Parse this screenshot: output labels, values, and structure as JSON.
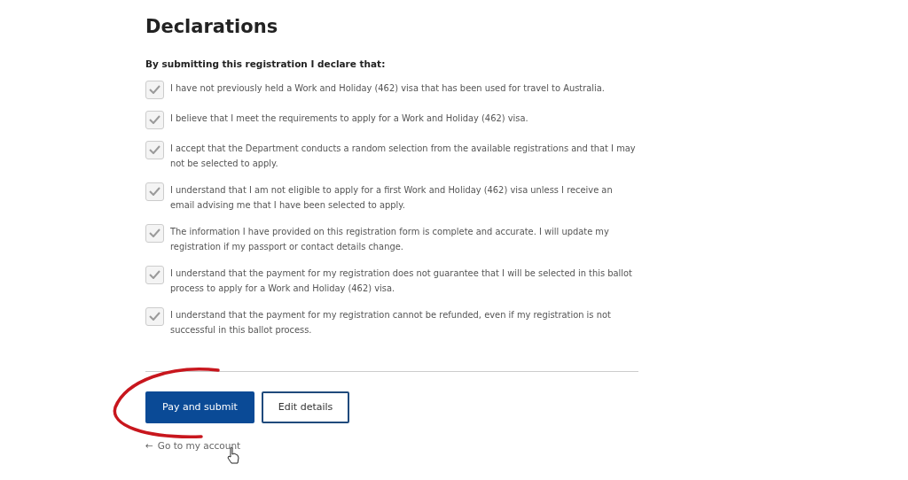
{
  "heading": "Declarations",
  "intro": "By submitting this registration I declare that:",
  "declarations": [
    {
      "text": "I have not previously held a Work and Holiday (462) visa that has been used for travel to Australia.",
      "checked": true,
      "disabled": true
    },
    {
      "text": "I believe that I meet the requirements to apply for a Work and Holiday (462) visa.",
      "checked": true,
      "disabled": true
    },
    {
      "text": "I accept that the Department conducts a random selection from the available registrations and that I may not be selected to apply.",
      "checked": true,
      "disabled": true
    },
    {
      "text": "I understand that I am not eligible to apply for a first Work and Holiday (462) visa unless I receive an email advising me that I have been selected to apply.",
      "checked": true,
      "disabled": true
    },
    {
      "text": "The information I have provided on this registration form is complete and accurate. I will update my registration if my passport or contact details change.",
      "checked": true,
      "disabled": true
    },
    {
      "text": "I understand that the payment for my registration does not guarantee that I will be selected in this ballot process to apply for a Work and Holiday (462) visa.",
      "checked": true,
      "disabled": true
    },
    {
      "text": "I understand that the payment for my registration cannot be refunded, even if my registration is not successful in this ballot process.",
      "checked": true,
      "disabled": true
    }
  ],
  "buttons": [
    {
      "label": "Pay and submit",
      "kind": "primary"
    },
    {
      "label": "Edit details",
      "kind": "outline"
    }
  ],
  "back_link": {
    "icon": "←",
    "label": "Go to my account"
  }
}
